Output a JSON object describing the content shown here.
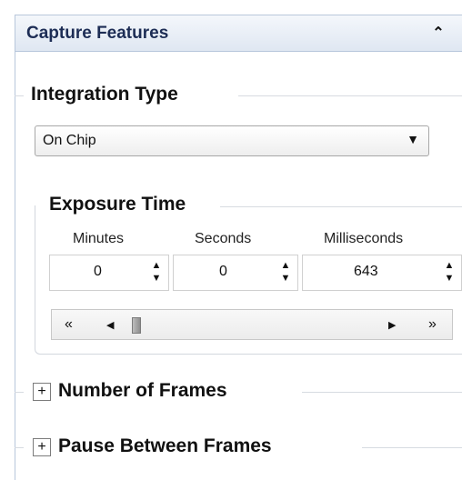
{
  "panel": {
    "title": "Capture Features",
    "collapse_glyph": "˄"
  },
  "integration": {
    "title": "Integration Type",
    "selected": "On Chip",
    "dropdown_arrow": "▼"
  },
  "exposure": {
    "title": "Exposure Time",
    "columns": [
      {
        "label": "Minutes",
        "value": "0"
      },
      {
        "label": "Seconds",
        "value": "0"
      },
      {
        "label": "Milliseconds",
        "value": "643"
      }
    ],
    "scroll": {
      "first": "«",
      "prev": "◀",
      "next": "▶",
      "last": "»"
    }
  },
  "sections": {
    "frames": {
      "expand_glyph": "+",
      "label": "Number of Frames"
    },
    "pause": {
      "expand_glyph": "+",
      "label": "Pause Between Frames"
    }
  },
  "icons": [
    "collapse-chevron-icon",
    "dropdown-arrow-icon",
    "spin-up-icon",
    "spin-down-icon",
    "scroll-first-icon",
    "scroll-prev-icon",
    "scroll-next-icon",
    "scroll-last-icon",
    "expand-plus-icon"
  ]
}
